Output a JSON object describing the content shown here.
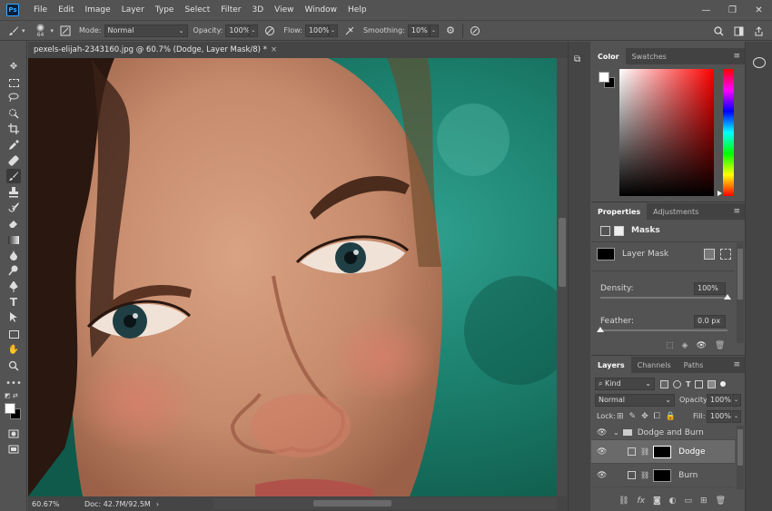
{
  "app": {
    "logo": "Ps"
  },
  "menu": [
    "File",
    "Edit",
    "Image",
    "Layer",
    "Type",
    "Select",
    "Filter",
    "3D",
    "View",
    "Window",
    "Help"
  ],
  "window_controls": {
    "minimize": "—",
    "restore": "❐",
    "close": "✕"
  },
  "options": {
    "brush_size": "64",
    "mode_label": "Mode:",
    "mode_value": "Normal",
    "opacity_label": "Opacity:",
    "opacity_value": "100%",
    "flow_label": "Flow:",
    "flow_value": "100%",
    "smoothing_label": "Smoothing:",
    "smoothing_value": "10%"
  },
  "document": {
    "tab_title": "pexels-elijah-2343160.jpg @ 60.7% (Dodge, Layer Mask/8) *",
    "close": "×",
    "zoom": "60.67%",
    "doc_size": "Doc: 42.7M/92.5M"
  },
  "color_panel": {
    "tabs": [
      "Color",
      "Swatches"
    ]
  },
  "properties_panel": {
    "tabs": [
      "Properties",
      "Adjustments"
    ],
    "section": "Masks",
    "mask_name": "Layer Mask",
    "density_label": "Density:",
    "density_value": "100%",
    "density": 1.0,
    "feather_label": "Feather:",
    "feather_value": "0.0 px",
    "feather": 0.0
  },
  "layers_panel": {
    "tabs": [
      "Layers",
      "Channels",
      "Paths"
    ],
    "filter": "Kind",
    "blend_mode": "Normal",
    "opacity_label": "Opacity:",
    "opacity_value": "100%",
    "lock_label": "Lock:",
    "fill_label": "Fill:",
    "fill_value": "100%",
    "group_name": "Dodge and Burn",
    "layers": [
      {
        "name": "Dodge",
        "selected": true
      },
      {
        "name": "Burn",
        "selected": false
      }
    ]
  },
  "colors": {
    "accent": "#31a8ff",
    "panel": "#535353",
    "dark": "#454545",
    "canvas_bg": "#1d7a6b"
  }
}
